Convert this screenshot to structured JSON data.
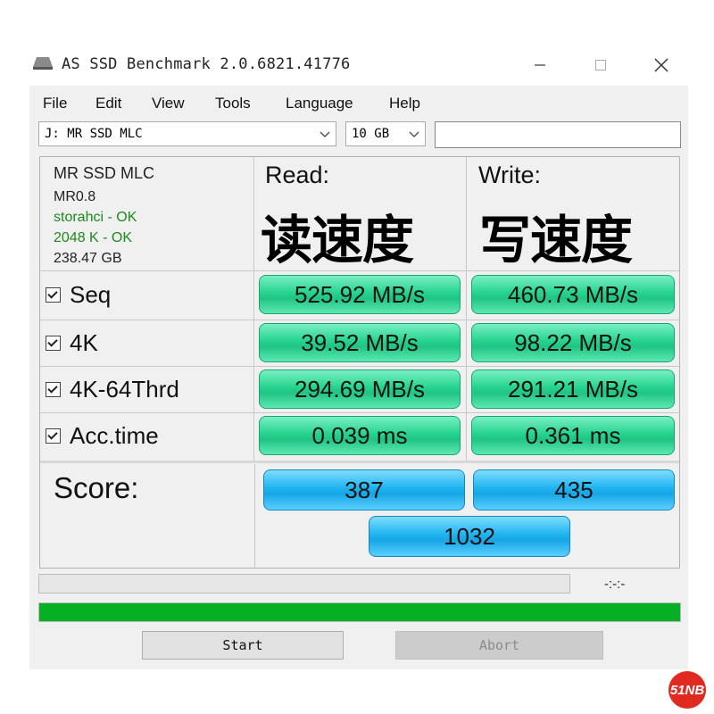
{
  "window": {
    "title": "AS SSD Benchmark 2.0.6821.41776",
    "controls": {
      "minimize": "—",
      "maximize": "☐",
      "close": "✕"
    }
  },
  "menu": [
    "File",
    "Edit",
    "View",
    "Tools",
    "Language",
    "Help"
  ],
  "drive_select": {
    "value": "J: MR SSD MLC"
  },
  "size_select": {
    "value": "10 GB"
  },
  "text_field": {
    "value": ""
  },
  "drive_info": {
    "name": "MR SSD MLC",
    "firmware": "MR0.8",
    "driver": "storahci - OK",
    "alignment": "2048 K - OK",
    "capacity": "238.47 GB"
  },
  "columns": {
    "read_label": "Read:",
    "write_label": "Write:",
    "read_cn": "读速度",
    "write_cn": "写速度"
  },
  "rows": [
    {
      "label": "Seq",
      "read": "525.92 MB/s",
      "write": "460.73 MB/s"
    },
    {
      "label": "4K",
      "read": "39.52 MB/s",
      "write": "98.22 MB/s"
    },
    {
      "label": "4K-64Thrd",
      "read": "294.69 MB/s",
      "write": "291.21 MB/s"
    },
    {
      "label": "Acc.time",
      "read": "0.039 ms",
      "write": "0.361 ms"
    }
  ],
  "score": {
    "label": "Score:",
    "read": "387",
    "write": "435",
    "total": "1032"
  },
  "status": {
    "time": "-:-:-",
    "progress": 1.0
  },
  "buttons": {
    "start": "Start",
    "abort": "Abort"
  },
  "watermark": "51NB",
  "colors": {
    "result_green": "#26d48e",
    "score_blue": "#1fb4ef",
    "progress_green": "#06b025"
  }
}
